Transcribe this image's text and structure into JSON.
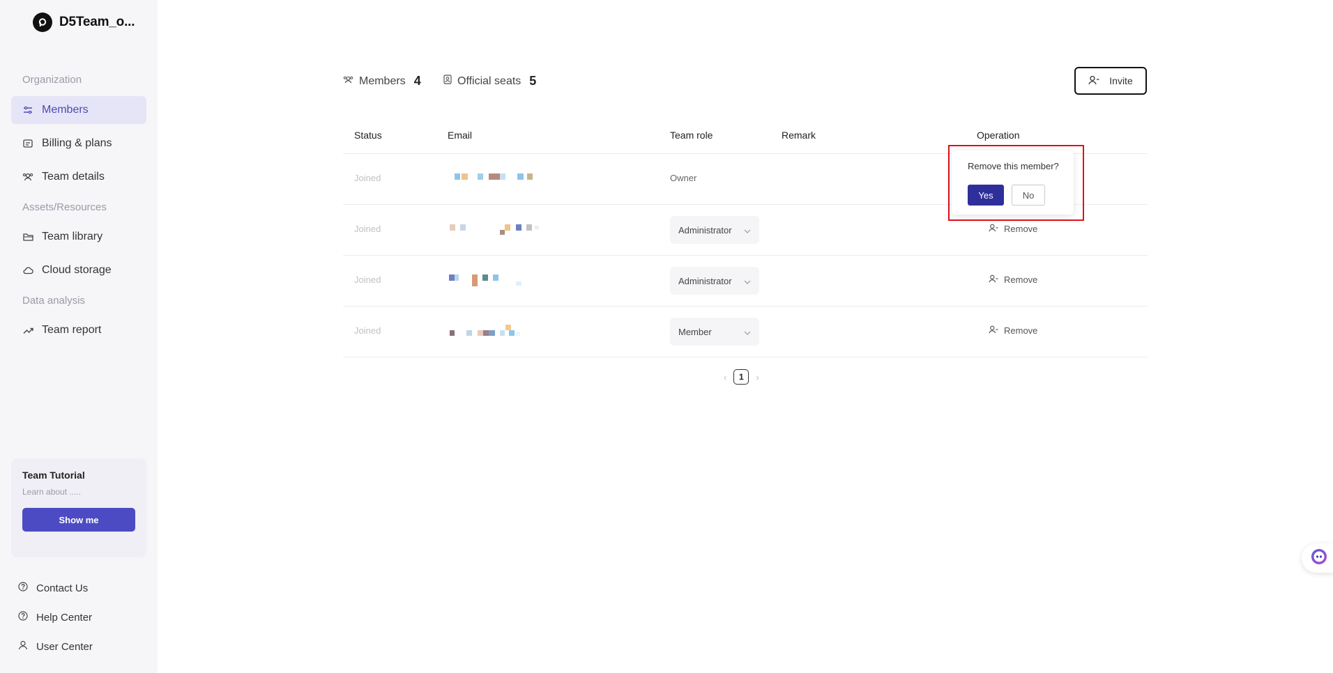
{
  "brand": {
    "name": "D5Team_o..."
  },
  "sidebar": {
    "sections": {
      "organization": "Organization",
      "assets": "Assets/Resources",
      "data": "Data analysis"
    },
    "items": [
      {
        "label": "Members",
        "icon": "sliders-icon",
        "active": true
      },
      {
        "label": "Billing & plans",
        "icon": "billing-icon"
      },
      {
        "label": "Team details",
        "icon": "team-icon"
      },
      {
        "label": "Team library",
        "icon": "folder-icon"
      },
      {
        "label": "Cloud storage",
        "icon": "cloud-icon"
      },
      {
        "label": "Team report",
        "icon": "trend-icon"
      }
    ],
    "tutorial": {
      "title": "Team Tutorial",
      "subtitle": "Learn about .....",
      "button": "Show me"
    },
    "footer": [
      {
        "label": "Contact Us",
        "icon": "question-circle-icon"
      },
      {
        "label": "Help Center",
        "icon": "question-circle-icon"
      },
      {
        "label": "User Center",
        "icon": "user-icon"
      }
    ]
  },
  "stats": {
    "members_label": "Members",
    "members_count": "4",
    "seats_label": "Official seats",
    "seats_count": "5"
  },
  "invite_label": "Invite",
  "table": {
    "headers": [
      "Status",
      "Email",
      "Team role",
      "Remark",
      "Operation"
    ],
    "rows": [
      {
        "status": "Joined",
        "role": "Owner",
        "operation": ""
      },
      {
        "status": "Joined",
        "role": "Administrator",
        "operation": "Remove"
      },
      {
        "status": "Joined",
        "role": "Administrator",
        "operation": "Remove"
      },
      {
        "status": "Joined",
        "role": "Member",
        "operation": "Remove"
      }
    ]
  },
  "pagination": {
    "current": "1"
  },
  "popconfirm": {
    "message": "Remove this member?",
    "yes": "Yes",
    "no": "No"
  },
  "colors": {
    "accent": "#4d4bc4",
    "confirm": "#2f2f9b",
    "highlight": "#e0101a",
    "active_bg": "#e6e5f7"
  }
}
